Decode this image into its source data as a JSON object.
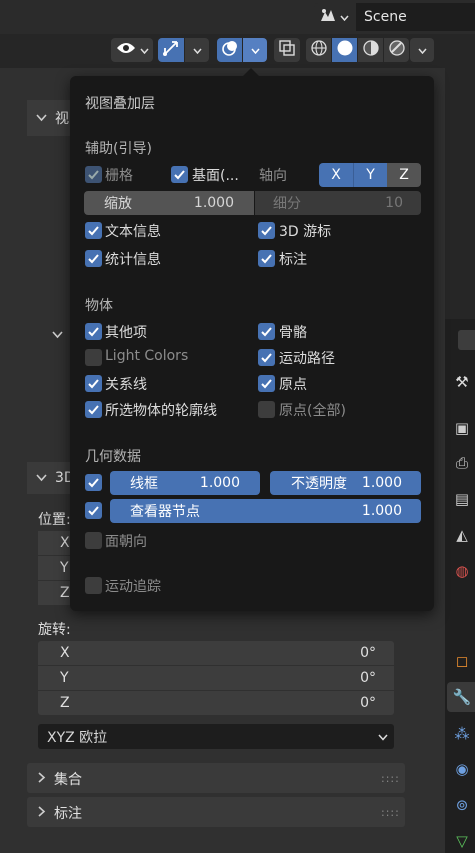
{
  "scene": {
    "name": "Scene"
  },
  "popover": {
    "title": "视图叠加层",
    "guides": {
      "heading": "辅助(引导)",
      "grid": "栅格",
      "floor": "基面(...",
      "axes_label": "轴向",
      "axis_x": "X",
      "axis_y": "Y",
      "axis_z": "Z",
      "scale_label": "缩放",
      "scale_value": "1.000",
      "subdiv_label": "细分",
      "subdiv_value": "10",
      "text_info": "文本信息",
      "cursor_3d": "3D 游标",
      "statistics": "统计信息",
      "annotations": "标注"
    },
    "objects": {
      "heading": "物体",
      "extras": "其他项",
      "bones": "骨骼",
      "light_colors": "Light Colors",
      "motion_paths": "运动路径",
      "relationship_lines": "关系线",
      "origins": "原点",
      "outline_selected": "所选物体的轮廓线",
      "origins_all": "原点(全部)"
    },
    "geometry": {
      "heading": "几何数据",
      "wireframe_label": "线框",
      "wireframe_value": "1.000",
      "opacity_label": "不透明度",
      "opacity_value": "1.000",
      "viewer_label": "查看器节点",
      "viewer_value": "1.000",
      "face_orientation": "面朝向",
      "motion_tracking": "运动追踪"
    }
  },
  "npanel": {
    "view_heading_partial": "视",
    "section_3d_partial": "3D",
    "location_partial": "位置:",
    "loc_axes": [
      "X",
      "Y",
      "Z"
    ],
    "rotation_label": "旋转:",
    "rotation": [
      {
        "axis": "X",
        "value": "0°"
      },
      {
        "axis": "Y",
        "value": "0°"
      },
      {
        "axis": "Z",
        "value": "0°"
      }
    ],
    "rotation_mode": "XYZ 欧拉",
    "collections_label": "集合",
    "annotations_label": "标注"
  },
  "colors": {
    "accent": "#4772b3",
    "panel": "#181818",
    "field": "#545454"
  }
}
